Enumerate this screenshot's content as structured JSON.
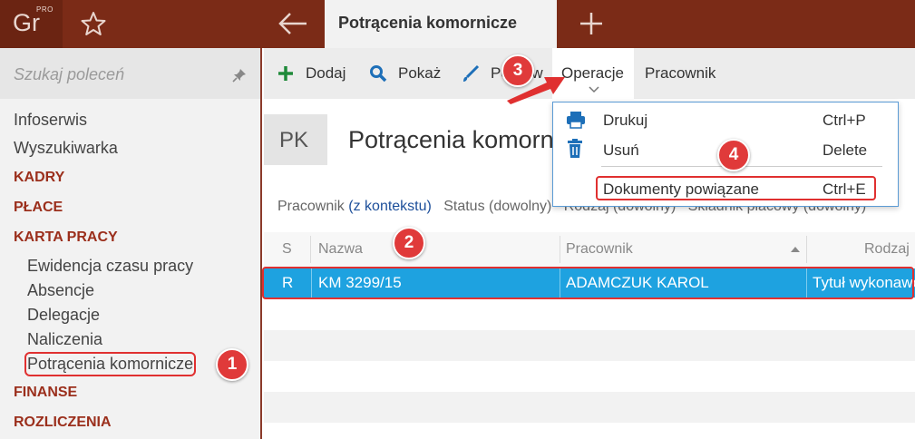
{
  "app": {
    "logo_text": "Gr",
    "logo_badge": "PRO",
    "active_tab": "Potrącenia komornicze"
  },
  "sidebar": {
    "search_placeholder": "Szukaj poleceń",
    "items": [
      {
        "label": "Infoserwis",
        "kind": "link"
      },
      {
        "label": "Wyszukiwarka",
        "kind": "link"
      },
      {
        "label": "KADRY",
        "kind": "category"
      },
      {
        "label": "PŁACE",
        "kind": "category"
      },
      {
        "label": "KARTA PRACY",
        "kind": "category"
      },
      {
        "label": "Ewidencja czasu pracy",
        "kind": "sub"
      },
      {
        "label": "Absencje",
        "kind": "sub"
      },
      {
        "label": "Delegacje",
        "kind": "sub"
      },
      {
        "label": "Naliczenia",
        "kind": "sub"
      },
      {
        "label": "Potrącenia komornicze",
        "kind": "sub",
        "selected": true
      },
      {
        "label": "FINANSE",
        "kind": "category"
      },
      {
        "label": "ROZLICZENIA",
        "kind": "category"
      }
    ]
  },
  "toolbar": {
    "add": "Dodaj",
    "show": "Pokaż",
    "edit": "Popraw",
    "operations": "Operacje",
    "employee": "Pracownik"
  },
  "header": {
    "badge": "PK",
    "title": "Potrącenia komornicze"
  },
  "filters": {
    "employee_label": "Pracownik",
    "employee_value": "(z kontekstu)",
    "status": "Status (dowolny)",
    "type": "Rodzaj (dowolny)",
    "component": "Składnik płacowy (dowolny)"
  },
  "grid": {
    "columns": [
      "S",
      "Nazwa",
      "Pracownik",
      "Rodzaj"
    ],
    "rows": [
      {
        "s": "R",
        "name": "KM 3299/15",
        "employee": "ADAMCZUK KAROL",
        "type": "Tytuł wykonawczy"
      }
    ]
  },
  "dropdown": {
    "items": [
      {
        "label": "Drukuj",
        "shortcut": "Ctrl+P",
        "icon": "printer-icon"
      },
      {
        "label": "Usuń",
        "shortcut": "Delete",
        "icon": "trash-icon"
      },
      {
        "label": "Dokumenty powiązane",
        "shortcut": "Ctrl+E",
        "icon": ""
      }
    ]
  },
  "annotations": {
    "step1": "1",
    "step2": "2",
    "step3": "3",
    "step4": "4"
  },
  "colors": {
    "brand": "#7b2b17",
    "category": "#9b2f1c",
    "selection": "#1ea2e0",
    "highlight": "#e03030"
  }
}
